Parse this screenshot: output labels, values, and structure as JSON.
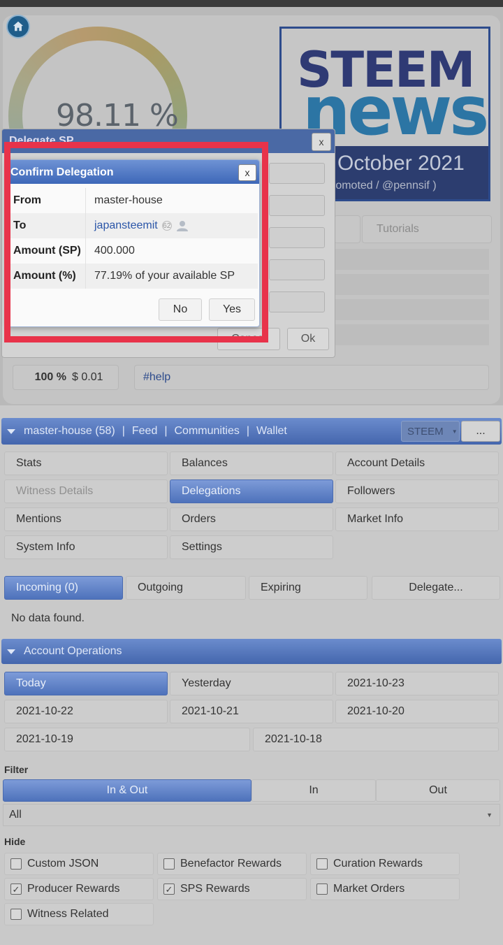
{
  "header": {
    "gauge_value": "98.11 %",
    "banner": {
      "line1": "STEEM",
      "line2": "news",
      "date": "October 2021",
      "subtitle": "romoted / @pennsif )"
    },
    "tutorials_tab": "Tutorials",
    "percent": "100 %",
    "amount": "$ 0.01",
    "tag": "#help"
  },
  "delegate_dialog": {
    "title": "Delegate SP",
    "close": "x",
    "cancel": "Cancel",
    "ok": "Ok"
  },
  "confirm_dialog": {
    "title": "Confirm Delegation",
    "close": "x",
    "rows": [
      {
        "label": "From",
        "value": "master-house"
      },
      {
        "label": "To",
        "value": "japansteemit",
        "badge": "62"
      },
      {
        "label": "Amount (SP)",
        "value": "400.000"
      },
      {
        "label": "Amount (%)",
        "value": "77.19% of your available SP"
      }
    ],
    "no": "No",
    "yes": "Yes"
  },
  "navbar": {
    "account": "master-house (58)",
    "feed": "Feed",
    "communities": "Communities",
    "wallet": "Wallet",
    "currency": "STEEM",
    "more": "..."
  },
  "menu": [
    "Stats",
    "Balances",
    "Account Details",
    "Witness Details",
    "Delegations",
    "Followers",
    "Mentions",
    "Orders",
    "Market Info",
    "System Info",
    "Settings"
  ],
  "delegation_tabs": [
    "Incoming (0)",
    "Outgoing",
    "Expiring",
    "Delegate..."
  ],
  "no_data": "No data found.",
  "account_ops": {
    "title": "Account Operations",
    "dates": [
      "Today",
      "Yesterday",
      "2021-10-23",
      "2021-10-22",
      "2021-10-21",
      "2021-10-20",
      "2021-10-19",
      "2021-10-18"
    ]
  },
  "filter": {
    "label": "Filter",
    "options": [
      "In & Out",
      "In",
      "Out"
    ],
    "select_value": "All"
  },
  "hide": {
    "label": "Hide",
    "items": [
      {
        "label": "Custom JSON",
        "checked": false
      },
      {
        "label": "Benefactor Rewards",
        "checked": false
      },
      {
        "label": "Curation Rewards",
        "checked": false
      },
      {
        "label": "Producer Rewards",
        "checked": true
      },
      {
        "label": "SPS Rewards",
        "checked": true
      },
      {
        "label": "Market Orders",
        "checked": false
      },
      {
        "label": "Witness Related",
        "checked": false
      }
    ]
  },
  "colors": {
    "accent_blue": "#4466ad",
    "highlight_red": "#e8334a"
  }
}
